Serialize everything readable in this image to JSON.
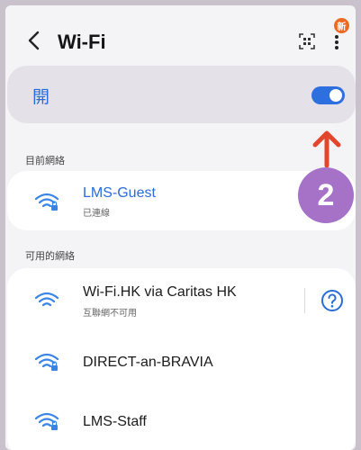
{
  "header": {
    "title": "Wi-Fi",
    "back_icon": "chevron-left-icon",
    "scan_icon": "qr-scan-icon",
    "more_icon": "more-vert-icon",
    "new_badge": "新"
  },
  "toggle": {
    "label": "開",
    "state": "on",
    "color": "#2e6fe0"
  },
  "annotation": {
    "step_number": "2",
    "badge_color": "#a572c8",
    "arrow_color": "#e2462b"
  },
  "current_section": {
    "label": "目前網絡",
    "network": {
      "name": "LMS-Guest",
      "status": "已連線",
      "icon": "wifi-lock-icon"
    }
  },
  "available_section": {
    "label": "可用的網絡",
    "networks": [
      {
        "name": "Wi-Fi.HK via Caritas HK",
        "status": "互聯網不可用",
        "icon": "wifi-icon",
        "info_icon": "help-circle-icon"
      },
      {
        "name": "DIRECT-an-BRAVIA",
        "icon": "wifi-lock-icon"
      },
      {
        "name": "LMS-Staff",
        "icon": "wifi-lock-icon"
      }
    ]
  }
}
